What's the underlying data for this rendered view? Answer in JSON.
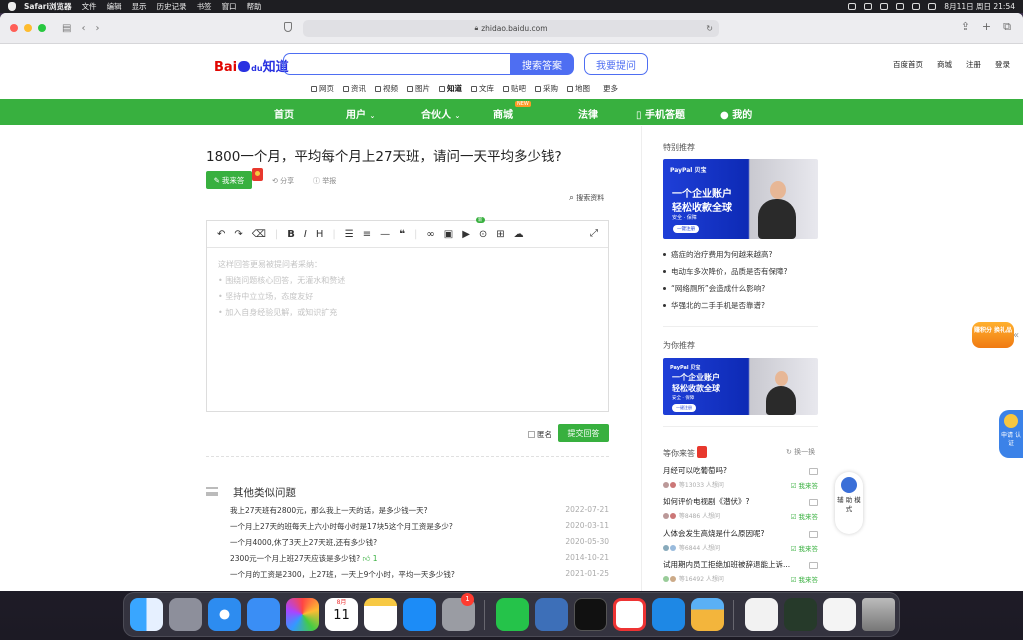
{
  "menubar": {
    "app": "Safari浏览器",
    "items": [
      "文件",
      "编辑",
      "显示",
      "历史记录",
      "书签",
      "窗口",
      "帮助"
    ],
    "clock": "8月11日 周日 21:54"
  },
  "browser": {
    "url": "zhidao.baidu.com"
  },
  "header": {
    "logo_bai": "Bai",
    "logo_du": "du",
    "logo_zhidao": "知道",
    "search_button": "搜索答案",
    "ask_button": "我要提问",
    "search_value": "",
    "top_links": [
      "百度首页",
      "商城",
      "注册",
      "登录"
    ],
    "categories": [
      "网页",
      "资讯",
      "视频",
      "图片",
      "知道",
      "文库",
      "贴吧",
      "采购",
      "地图",
      "更多"
    ]
  },
  "nav": {
    "items": [
      "首页",
      "用户",
      "合伙人",
      "商城",
      "法律",
      "手机答题",
      "我的"
    ],
    "new_tag": "NEW"
  },
  "question": {
    "title": "1800一个月，平均每个月上27天班，请问一天平均多少钱?",
    "answer_button": "我来答",
    "share": "分享",
    "report": "举报",
    "search_ref": "搜索资料"
  },
  "editor": {
    "placeholder_lines": [
      "这样回答更易被提问者采纳：",
      "• 围绕问题核心回答，无灌水和赘述",
      "• 坚持中立立场，态度友好",
      "• 加入自身经验见解，或知识扩充"
    ],
    "anonymous": "匿名",
    "submit": "提交回答",
    "tool_icons": [
      "undo",
      "redo",
      "eraser",
      "bold",
      "italic",
      "heading",
      "ul",
      "ol",
      "hr",
      "quote",
      "link",
      "image",
      "video",
      "location",
      "table",
      "cloud"
    ],
    "new_tag": "新"
  },
  "similar": {
    "title": "其他类似问题",
    "rows": [
      {
        "q": "我上27天班有2800元，那么我上一天的话，是多少钱一天?",
        "d": "2022-07-21"
      },
      {
        "q": "一个月上27天的班每天上六小时每小时是17块5这个月工资是多少?",
        "d": "2020-03-11"
      },
      {
        "q": "一个月4000,休了3天上27天班,还有多少钱?",
        "d": "2020-05-30"
      },
      {
        "q": "2300元一个月上班27天应该是多少钱?",
        "d": "2014-10-21",
        "likes": "1"
      },
      {
        "q": "一个月的工资是2300，上27班，一天上9个小时，平均一天多少钱?",
        "d": "2021-01-25"
      }
    ]
  },
  "sidebar": {
    "special": "特别推荐",
    "for_you": "为你推荐",
    "ad": {
      "brand": "PayPal 贝宝",
      "line1": "一个企业账户",
      "line2": "轻松收款全球",
      "tags": "安全 · 保障",
      "btn": "一键注册"
    },
    "recs": [
      "癌症的治疗费用为何越来越高?",
      "电动车多次降价，品质是否有保障?",
      "“网络厕所”会造成什么影响?",
      "华强北的二手手机是否靠谱?"
    ],
    "wait_title": "等你来答",
    "swap": "换一换",
    "wait": [
      {
        "q": "月经可以吃葡萄吗?",
        "m": "等13033 人想问",
        "a": "我来答"
      },
      {
        "q": "如何评价电视剧《潜伏》?",
        "m": "等8486 人想问",
        "a": "我来答"
      },
      {
        "q": "人体会发生高烧是什么原因呢?",
        "m": "等6844 人想问",
        "a": "我来答"
      },
      {
        "q": "试用期内员工拒绝加班被辞退能上诉...",
        "m": "等16492 人想问",
        "a": "我来答"
      }
    ]
  },
  "floats": {
    "points": "赚积分 换礼品",
    "cert": "申请 认证",
    "mode": "辅 助 模 式"
  },
  "dock": {
    "calendar_month": "8月",
    "calendar_day": "11",
    "settings_badge": "1"
  }
}
